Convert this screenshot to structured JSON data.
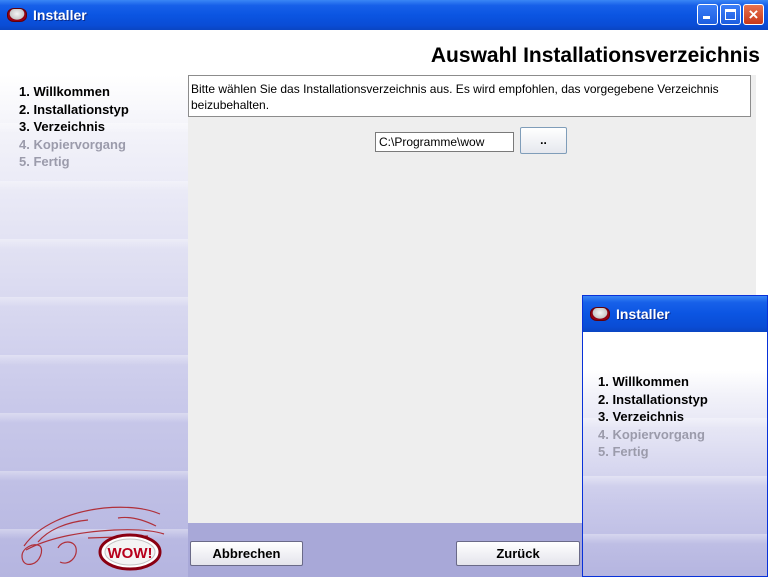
{
  "main_window": {
    "title": "Installer",
    "heading": "Auswahl Installationsverzeichnis",
    "steps": [
      {
        "label": "1. Willkommen",
        "state": "done"
      },
      {
        "label": "2. Installationstyp",
        "state": "done"
      },
      {
        "label": "3. Verzeichnis",
        "state": "current"
      },
      {
        "label": "4. Kopiervorgang",
        "state": "disabled"
      },
      {
        "label": "5. Fertig",
        "state": "disabled"
      }
    ],
    "description": "Bitte wählen Sie das Installationsverzeichnis aus. Es wird empfohlen, das vorgegebene Verzeichnis beizubehalten.",
    "path_value": "C:\\Programme\\wow",
    "browse_label": "..",
    "cancel_label": "Abbrechen",
    "back_label": "Zurück",
    "logo_text": "WOW!"
  },
  "second_window": {
    "title": "Installer",
    "steps": [
      {
        "label": "1. Willkommen",
        "state": "done"
      },
      {
        "label": "2. Installationstyp",
        "state": "done"
      },
      {
        "label": "3. Verzeichnis",
        "state": "current"
      },
      {
        "label": "4. Kopiervorgang",
        "state": "disabled"
      },
      {
        "label": "5. Fertig",
        "state": "disabled"
      }
    ]
  },
  "colors": {
    "titlebar": "#0a4cd5",
    "close_button": "#d6451f",
    "disabled_step": "#9b9bab",
    "bottom_bar": "#a8a8d8"
  }
}
